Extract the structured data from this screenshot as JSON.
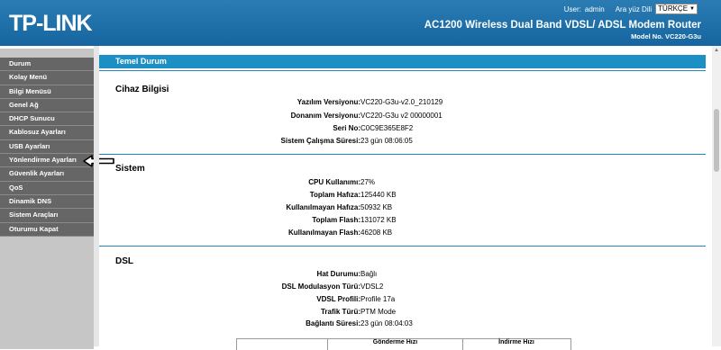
{
  "header": {
    "logo": "TP-LINK",
    "user_label": "User:",
    "user_name": "admin",
    "language_label": "Ara yüz Dili",
    "language_value": "TÜRKÇE",
    "product_name": "AC1200 Wireless Dual Band VDSL/ ADSL Modem Router",
    "model": "Model No. VC220-G3u"
  },
  "sidebar": {
    "items": [
      {
        "label": "Durum"
      },
      {
        "label": "Kolay Menü"
      },
      {
        "label": "Bilgi Menüsü"
      },
      {
        "label": "Genel Ağ"
      },
      {
        "label": "DHCP Sunucu"
      },
      {
        "label": "Kablosuz Ayarları"
      },
      {
        "label": "USB Ayarları"
      },
      {
        "label": "Yönlendirme Ayarları"
      },
      {
        "label": "Güvenlik Ayarları"
      },
      {
        "label": "QoS"
      },
      {
        "label": "Dinamik DNS"
      },
      {
        "label": "Sistem Araçları"
      },
      {
        "label": "Oturumu Kapat"
      }
    ]
  },
  "main": {
    "title": "Temel Durum",
    "device": {
      "heading": "Cihaz Bilgisi",
      "rows": [
        {
          "label": "Yazılım Versiyonu:",
          "value": "VC220-G3u-v2.0_210129"
        },
        {
          "label": "Donanım Versiyonu:",
          "value": "VC220-G3u v2 00000001"
        },
        {
          "label": "Seri No:",
          "value": "C0C9E365E8F2"
        },
        {
          "label": "Sistem Çalışma Süresi:",
          "value": "23 gün 08:06:05"
        }
      ]
    },
    "system": {
      "heading": "Sistem",
      "rows": [
        {
          "label": "CPU Kullanımı:",
          "value": "27%"
        },
        {
          "label": "Toplam Hafıza:",
          "value": "125440 KB"
        },
        {
          "label": "Kullanılmayan Hafıza:",
          "value": "50932 KB"
        },
        {
          "label": "Toplam Flash:",
          "value": "131072 KB"
        },
        {
          "label": "Kullanılmayan Flash:",
          "value": "46208 KB"
        }
      ]
    },
    "dsl": {
      "heading": "DSL",
      "rows": [
        {
          "label": "Hat Durumu:",
          "value": "Bağlı"
        },
        {
          "label": "DSL Modulasyon Türü:",
          "value": "VDSL2"
        },
        {
          "label": "VDSL Profili:",
          "value": "Profile 17a"
        },
        {
          "label": "Trafik Türü:",
          "value": "PTM Mode"
        },
        {
          "label": "Bağlantı Süresi:",
          "value": "23 gün 08:04:03"
        }
      ],
      "table_headers": [
        "Gönderme Hızı",
        "İndirme Hızı"
      ]
    }
  }
}
